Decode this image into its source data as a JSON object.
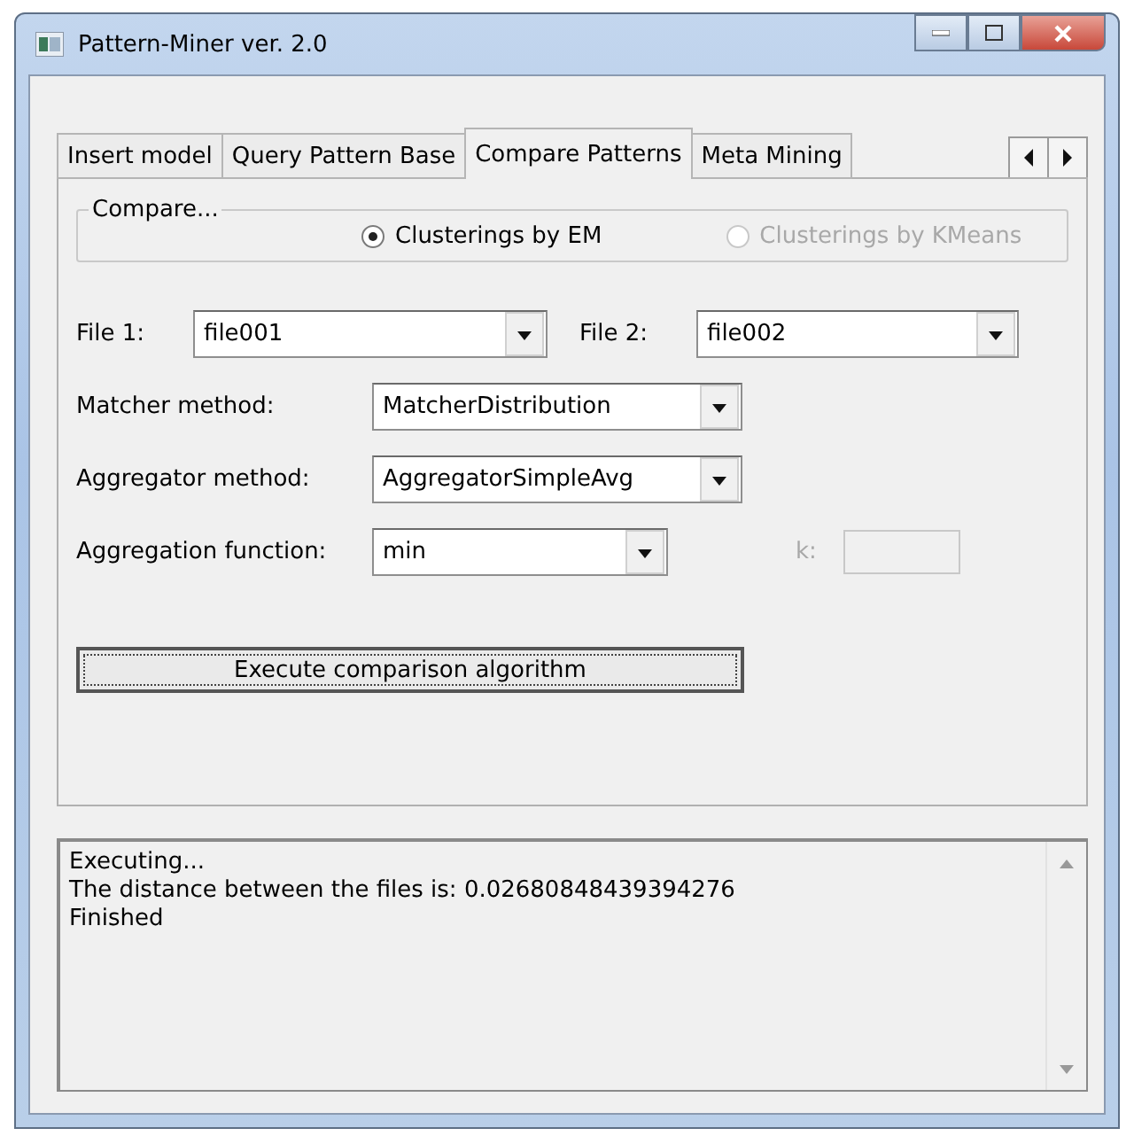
{
  "window": {
    "title": "Pattern-Miner ver. 2.0"
  },
  "tabs": [
    {
      "label": "Insert model",
      "selected": false
    },
    {
      "label": "Query Pattern Base",
      "selected": false
    },
    {
      "label": "Compare Patterns",
      "selected": true
    },
    {
      "label": "Meta Mining",
      "selected": false
    }
  ],
  "compare_group": {
    "title": "Compare...",
    "options": [
      {
        "label": "Clusterings by EM",
        "selected": true,
        "disabled": false
      },
      {
        "label": "Clusterings by KMeans",
        "selected": false,
        "disabled": true
      }
    ]
  },
  "file1": {
    "label": "File 1:",
    "value": "file001"
  },
  "file2": {
    "label": "File 2:",
    "value": "file002"
  },
  "matcher": {
    "label": "Matcher method:",
    "value": "MatcherDistribution"
  },
  "aggregator": {
    "label": "Aggregator method:",
    "value": "AggregatorSimpleAvg"
  },
  "aggregation_function": {
    "label": "Aggregation function:",
    "value": "min"
  },
  "k": {
    "label": "k:",
    "disabled": true
  },
  "execute_button": "Execute comparison algorithm",
  "output": [
    "Executing...",
    "The distance between the files is: 0.02680848439394276",
    "Finished"
  ]
}
